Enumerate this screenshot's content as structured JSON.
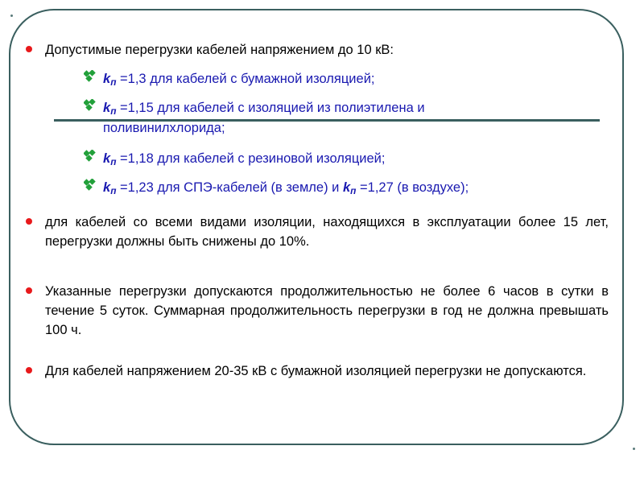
{
  "slide": {
    "frame_color": "#3a5f5f",
    "bullet_color": "#e8191b",
    "sub_bullet_color": "#22a03a",
    "sub_text_color": "#1919b0",
    "text_color": "#000000",
    "rule_color": "#3a5f5f"
  },
  "intro": {
    "text": "Допустимые перегрузки кабелей напряжением до 10 кВ:"
  },
  "sub_items": [
    {
      "icon": "green-diamond-bullet",
      "symbol": "kп",
      "k": "k",
      "sub": "п",
      "value": " =1,3",
      "text": " для кабелей с бумажной изоляцией;"
    },
    {
      "icon": "green-diamond-bullet",
      "symbol": "kп",
      "k": "k",
      "sub": "п",
      "value": " =1,15",
      "text": " для кабелей с изоляцией из полиэтилена и",
      "continuation": "поливинилхлорида;"
    },
    {
      "icon": "green-diamond-bullet",
      "symbol": "kп",
      "k": "k",
      "sub": "п",
      "value": " =1,18",
      "text": " для кабелей с резиновой изоляцией;"
    },
    {
      "icon": "green-diamond-bullet",
      "symbol": "kп",
      "k": "k",
      "sub": "п",
      "value": " =1,23",
      "text": " для СПЭ-кабелей (в земле) и ",
      "k2": "k",
      "sub2": "п",
      "value2": " =1,27",
      "text2": " (в воздухе);"
    }
  ],
  "paragraphs": [
    {
      "icon": "red-round-bullet",
      "text": "для кабелей со всеми видами изоляции, находящихся в эксплуатации более 15 лет, перегрузки должны быть снижены до 10%."
    },
    {
      "icon": "red-round-bullet",
      "text": "Указанные перегрузки допускаются продолжительностью не более 6 часов в сутки в течение 5 суток. Суммарная продолжительность перегрузки в год не должна превышать 100 ч."
    },
    {
      "icon": "red-round-bullet",
      "text": "Для кабелей напряжением 20-35 кВ с бумажной изоляцией перегрузки не допускаются."
    }
  ]
}
